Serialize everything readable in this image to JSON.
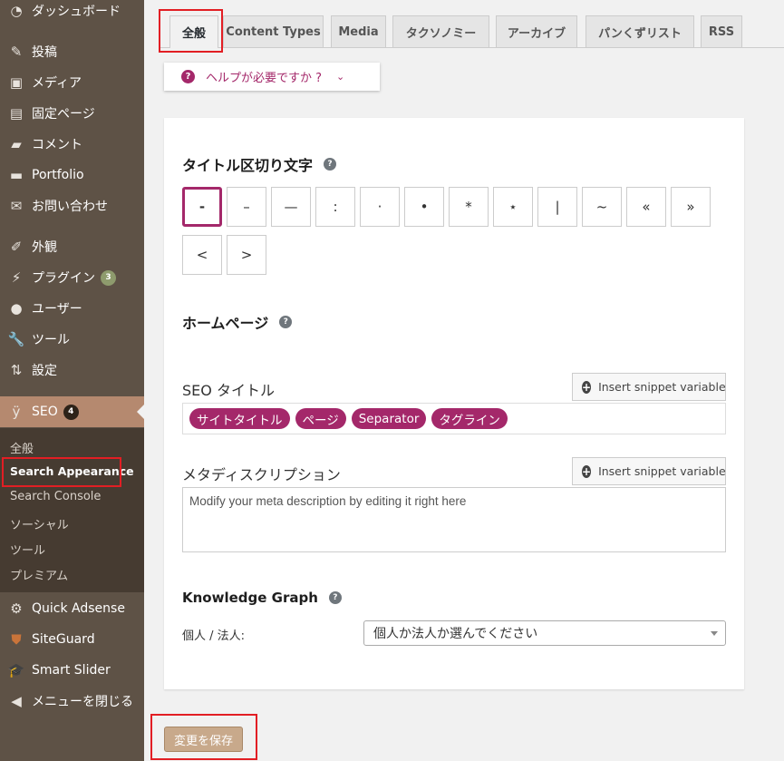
{
  "sidebar": {
    "items": [
      {
        "label": "ダッシュボード",
        "icon": "dashboard-icon"
      },
      {
        "label": "投稿",
        "icon": "pin-icon"
      },
      {
        "label": "メディア",
        "icon": "media-icon"
      },
      {
        "label": "固定ページ",
        "icon": "page-icon"
      },
      {
        "label": "コメント",
        "icon": "comment-icon"
      },
      {
        "label": "Portfolio",
        "icon": "folder-icon"
      },
      {
        "label": "お問い合わせ",
        "icon": "mail-icon"
      },
      {
        "label": "外観",
        "icon": "brush-icon"
      },
      {
        "label": "プラグイン",
        "icon": "plugin-icon",
        "badge": "3"
      },
      {
        "label": "ユーザー",
        "icon": "user-icon"
      },
      {
        "label": "ツール",
        "icon": "wrench-icon"
      },
      {
        "label": "設定",
        "icon": "settings-icon"
      },
      {
        "label": "SEO",
        "icon": "yoast-icon",
        "badge": "4"
      },
      {
        "label": "Quick Adsense",
        "icon": "gear-icon"
      },
      {
        "label": "SiteGuard",
        "icon": "shield-icon"
      },
      {
        "label": "Smart Slider",
        "icon": "graduation-cap-icon"
      },
      {
        "label": "メニューを閉じる",
        "icon": "collapse-icon"
      }
    ],
    "submenu": [
      "全般",
      "Search Appearance",
      "Search Console",
      "ソーシャル",
      "ツール",
      "プレミアム"
    ]
  },
  "tabs": [
    "全般",
    "Content Types",
    "Media",
    "タクソノミー",
    "アーカイブ",
    "パンくずリスト",
    "RSS"
  ],
  "help": {
    "label": "ヘルプが必要ですか ?"
  },
  "title_separator": {
    "heading": "タイトル区切り文字",
    "options": [
      "-",
      "–",
      "—",
      ":",
      "·",
      "•",
      "*",
      "⋆",
      "|",
      "~",
      "«",
      "»",
      "<",
      ">"
    ],
    "selected": "-"
  },
  "homepage": {
    "heading": "ホームページ",
    "seo_title_label": "SEO タイトル",
    "snippet_button": "Insert snippet variable",
    "seo_title_vars": [
      "サイトタイトル",
      "ページ",
      "Separator",
      "タグライン"
    ],
    "meta_label": "メタディスクリプション",
    "meta_placeholder": "Modify your meta description by editing it right here"
  },
  "knowledge_graph": {
    "heading": "Knowledge Graph",
    "label": "個人 / 法人:",
    "select_value": "個人か法人か選んでください"
  },
  "save_button": "変更を保存",
  "colors": {
    "accent": "#a4286a",
    "sidebar": "#5e5246",
    "active_menu": "#b5896f",
    "highlight": "#e21e24"
  }
}
